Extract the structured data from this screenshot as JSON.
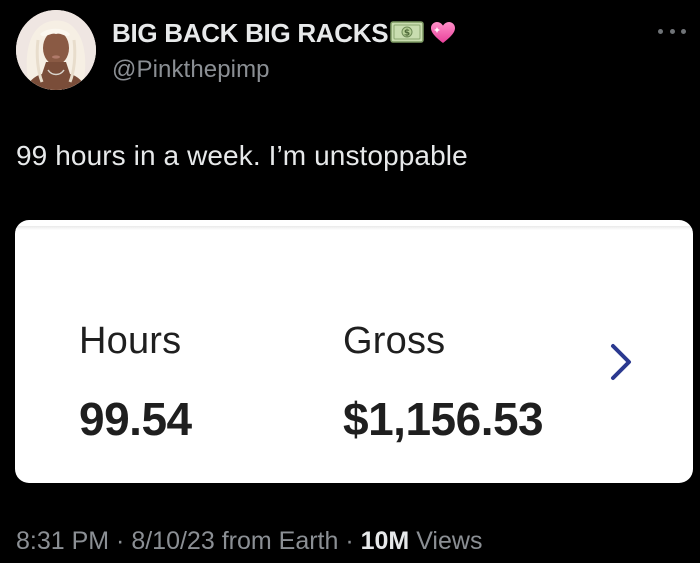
{
  "author": {
    "display_name": "BIG BACK BIG RACKS",
    "handle": "@Pinkthepimp",
    "name_emojis": [
      "money-bill-emoji",
      "sparkling-heart-emoji"
    ],
    "avatar_icon": "profile-photo"
  },
  "menu": {
    "icon": "more-options-icon"
  },
  "tweet": {
    "text": "99 hours in a week. I’m unstoppable"
  },
  "media": {
    "hours_label": "Hours",
    "hours_value": "99.54",
    "gross_label": "Gross",
    "gross_value": "$1,156.53",
    "chevron_icon": "chevron-right-icon",
    "accent_color": "#2b3990"
  },
  "footer": {
    "time": "8:31 PM",
    "sep1": " · ",
    "date": "8/10/23",
    "source": " from Earth",
    "sep2": " · ",
    "views_count": "10M",
    "views_label": " Views"
  }
}
